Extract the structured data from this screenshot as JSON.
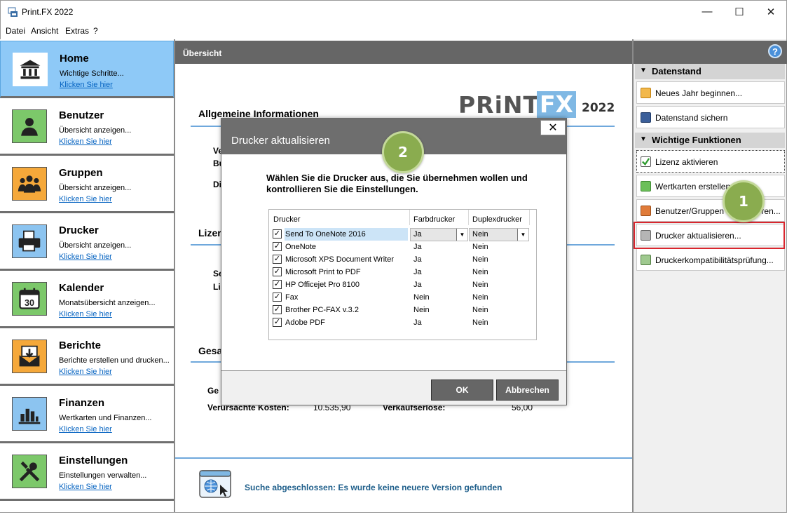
{
  "window": {
    "title": "Print.FX 2022",
    "controls": [
      "—",
      "☐",
      "✕"
    ]
  },
  "menu": [
    "Datei",
    "Ansicht",
    "Extras",
    "?"
  ],
  "nav": [
    {
      "title": "Home",
      "sub": "Wichtige Schritte...",
      "link": "Klicken Sie hier",
      "icon": "bank-icon",
      "color": "#ffffff"
    },
    {
      "title": "Benutzer",
      "sub": "Übersicht anzeigen...",
      "link": "Klicken Sie hier",
      "icon": "user-icon",
      "color": "#7cc86a"
    },
    {
      "title": "Gruppen",
      "sub": "Übersicht anzeigen...",
      "link": "Klicken Sie hier",
      "icon": "group-icon",
      "color": "#f5a83a"
    },
    {
      "title": "Drucker",
      "sub": "Übersicht anzeigen...",
      "link": "Klicken Sie hier",
      "icon": "printer-icon",
      "color": "#8cc4f0"
    },
    {
      "title": "Kalender",
      "sub": "Monatsübersicht anzeigen...",
      "link": "Klicken Sie hier",
      "icon": "calendar-icon",
      "color": "#7cc86a"
    },
    {
      "title": "Berichte",
      "sub": "Berichte erstellen und drucken...",
      "link": "Klicken Sie hier",
      "icon": "report-icon",
      "color": "#f5a83a"
    },
    {
      "title": "Finanzen",
      "sub": "Wertkarten und Finanzen...",
      "link": "Klicken Sie hier",
      "icon": "chart-icon",
      "color": "#8cc4f0"
    },
    {
      "title": "Einstellungen",
      "sub": "Einstellungen verwalten...",
      "link": "Klicken Sie hier",
      "icon": "tools-icon",
      "color": "#7cc86a"
    }
  ],
  "calendar_day": "30",
  "main": {
    "header": "Übersicht",
    "logo_print": "PRiNT",
    "logo_fx": "FX",
    "logo_year": "2022",
    "sections": {
      "allgemein": "Allgemeine Informationen",
      "lizenz": "Lizer",
      "gesamt": "Gesa"
    },
    "fragments": {
      "ve": "Ve",
      "bu": "Bu",
      "di": "Di",
      "se": "Se",
      "li": "Li",
      "ge": "Ge"
    },
    "costs_label": "Verursachte Kosten:",
    "costs_value": "10.535,90",
    "revenue_label": "Verkaufserlöse:",
    "revenue_value": "56,00",
    "status": "Suche abgeschlossen: Es wurde keine neuere Version gefunden"
  },
  "right": {
    "groups": [
      "Datenstand",
      "Wichtige Funktionen"
    ],
    "datenstand_buttons": [
      "Neues Jahr beginnen...",
      "Datenstand sichern"
    ],
    "funktionen_buttons": [
      "Lizenz aktivieren",
      "Wertkarten erstellen...",
      "Benutzer/Gruppen aktualisieren...",
      "Drucker aktualisieren...",
      "Druckerkompatibilitätsprüfung..."
    ],
    "help": "?"
  },
  "dialog": {
    "title": "Drucker aktualisieren",
    "close": "✕",
    "instruction": "Wählen Sie die Drucker aus, die Sie übernehmen wollen und kontrollieren Sie die Einstellungen.",
    "columns": [
      "Drucker",
      "Farbdrucker",
      "Duplexdrucker"
    ],
    "rows": [
      {
        "name": "Send To OneNote 2016",
        "farb": "Ja",
        "duplex": "Nein",
        "checked": true
      },
      {
        "name": "OneNote",
        "farb": "Ja",
        "duplex": "Nein",
        "checked": true
      },
      {
        "name": "Microsoft XPS Document Writer",
        "farb": "Ja",
        "duplex": "Nein",
        "checked": true
      },
      {
        "name": "Microsoft Print to PDF",
        "farb": "Ja",
        "duplex": "Nein",
        "checked": true
      },
      {
        "name": "HP Officejet Pro 8100",
        "farb": "Ja",
        "duplex": "Nein",
        "checked": true
      },
      {
        "name": "Fax",
        "farb": "Nein",
        "duplex": "Nein",
        "checked": true
      },
      {
        "name": "Brother PC-FAX v.3.2",
        "farb": "Nein",
        "duplex": "Nein",
        "checked": true
      },
      {
        "name": "Adobe PDF",
        "farb": "Ja",
        "duplex": "Nein",
        "checked": true
      }
    ],
    "ok": "OK",
    "cancel": "Abbrechen"
  },
  "badges": [
    "1",
    "2"
  ],
  "colors": {
    "accent": "#8ec9f7",
    "header_gray": "#666666",
    "badge_green": "#8aac4f",
    "highlight_red": "#d9262e",
    "link_blue": "#0563c1"
  }
}
